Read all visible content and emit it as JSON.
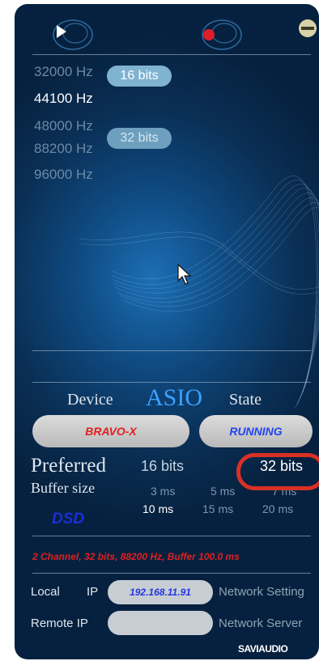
{
  "sample_rates": [
    "32000 Hz",
    "44100 Hz",
    "48000 Hz",
    "88200 Hz",
    "96000 Hz"
  ],
  "bits_options": [
    "16 bits",
    "32 bits"
  ],
  "device": {
    "device_label": "Device",
    "driver_label": "ASIO",
    "state_label": "State",
    "device_name": "BRAVO-X",
    "state_value": "RUNNING"
  },
  "preferred": {
    "label": "Preferred",
    "bits_16": "16 bits",
    "bits_32": "32 bits"
  },
  "buffer": {
    "label": "Buffer size",
    "options": [
      "3 ms",
      "5 ms",
      "7 ms",
      "10 ms",
      "15 ms",
      "20 ms"
    ]
  },
  "dsd_label": "DSD",
  "status_line": "2 Channel, 32 bits, 88200 Hz, Buffer 100.0 ms",
  "network": {
    "local_label": "Local",
    "ip_label": "IP",
    "local_ip": "192.168.11.91",
    "network_setting": "Network Setting",
    "remote_label": "Remote IP",
    "remote_ip": "",
    "network_server": "Network Server"
  },
  "brand": "SAVIAUDIO",
  "colors": {
    "accent_blue": "#3aa0ff",
    "red_text": "#e02020",
    "running_blue": "#2244ee",
    "highlight_ring": "#d93025"
  },
  "icons": [
    "play-icon",
    "record-icon",
    "minus-icon",
    "cursor-icon"
  ]
}
